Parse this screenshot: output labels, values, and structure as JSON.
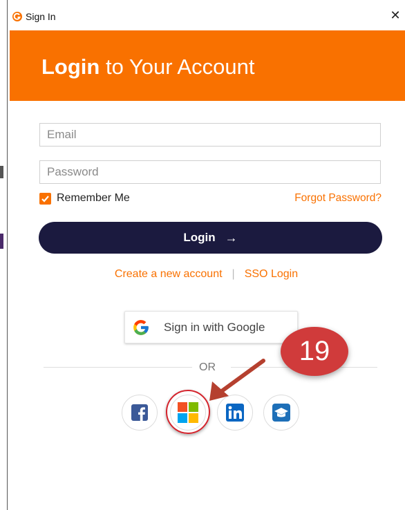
{
  "window": {
    "title": "Sign In",
    "close_symbol": "✕"
  },
  "header": {
    "bold": "Login",
    "rest": " to Your Account"
  },
  "form": {
    "email_placeholder": "Email",
    "password_placeholder": "Password",
    "remember_label": "Remember Me",
    "remember_checked": true,
    "forgot_label": "Forgot Password?",
    "login_label": "Login",
    "login_arrow": "→"
  },
  "links": {
    "create_account": "Create a new account",
    "separator": "|",
    "sso": "SSO Login"
  },
  "google": {
    "label": "Sign in with Google"
  },
  "divider": {
    "text": "OR"
  },
  "social": [
    {
      "name": "facebook-icon"
    },
    {
      "name": "microsoft-icon"
    },
    {
      "name": "linkedin-icon"
    },
    {
      "name": "graduation-cap-icon"
    }
  ],
  "annotation": {
    "step_number": "19"
  },
  "colors": {
    "accent": "#f97100",
    "button": "#1b1a3f",
    "annotation": "#d03b3b"
  }
}
